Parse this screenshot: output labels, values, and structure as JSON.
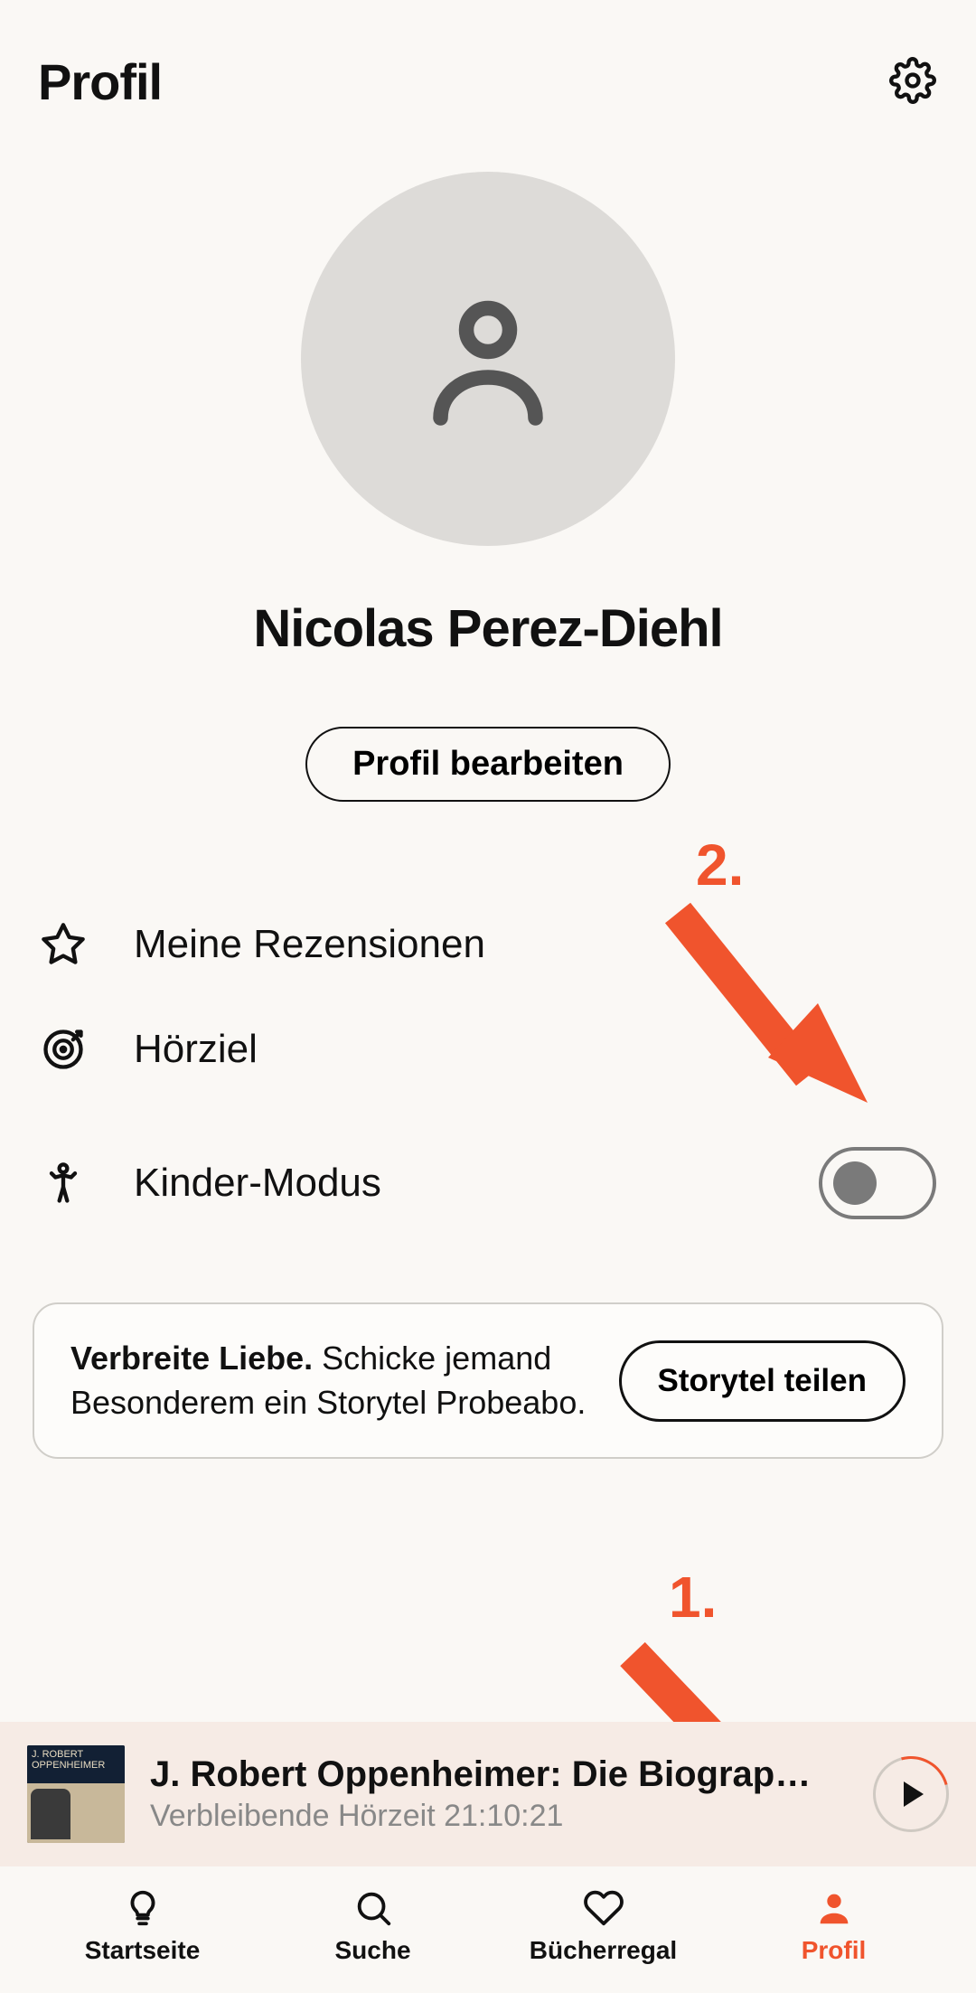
{
  "header": {
    "title": "Profil"
  },
  "profile": {
    "name": "Nicolas Perez-Diehl",
    "edit_label": "Profil bearbeiten"
  },
  "menu": {
    "reviews_label": "Meine Rezensionen",
    "goal_label": "Hörziel",
    "kids_label": "Kinder-Modus",
    "kids_toggle_on": false
  },
  "share": {
    "bold": "Verbreite Liebe.",
    "text": " Schicke jemand Besonderem ein Storytel Probeabo.",
    "button": "Storytel teilen"
  },
  "annotations": {
    "one": "1.",
    "two": "2."
  },
  "player": {
    "title": "J. Robert Oppenheimer: Die Biograp…",
    "subtitle": "Verbleibende Hörzeit 21:10:21",
    "cover_text": "J. ROBERT OPPENHEIMER"
  },
  "nav": {
    "home": "Startseite",
    "search": "Suche",
    "shelf": "Bücherregal",
    "profile": "Profil"
  },
  "colors": {
    "accent": "#f0542d"
  }
}
